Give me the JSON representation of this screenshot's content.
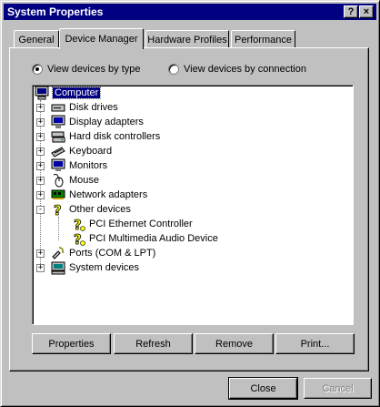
{
  "window": {
    "title": "System Properties",
    "help_glyph": "?",
    "close_glyph": "×"
  },
  "tabs": [
    {
      "label": "General"
    },
    {
      "label": "Device Manager"
    },
    {
      "label": "Hardware Profiles"
    },
    {
      "label": "Performance"
    }
  ],
  "view_options": {
    "by_type": "View devices by type",
    "by_connection": "View devices by connection",
    "selected": "by_type"
  },
  "tree": {
    "root": "Computer",
    "items": [
      {
        "label": "Disk drives",
        "icon": "disk-drive-icon",
        "expander": "+"
      },
      {
        "label": "Display adapters",
        "icon": "display-adapter-icon",
        "expander": "+"
      },
      {
        "label": "Hard disk controllers",
        "icon": "hard-disk-controller-icon",
        "expander": "+"
      },
      {
        "label": "Keyboard",
        "icon": "keyboard-icon",
        "expander": "+"
      },
      {
        "label": "Monitors",
        "icon": "monitor-icon",
        "expander": "+"
      },
      {
        "label": "Mouse",
        "icon": "mouse-icon",
        "expander": "+"
      },
      {
        "label": "Network adapters",
        "icon": "network-adapter-icon",
        "expander": "+"
      },
      {
        "label": "Other devices",
        "icon": "question-mark-icon",
        "expander": "-",
        "children": [
          {
            "label": "PCI Ethernet Controller",
            "icon": "unknown-device-icon"
          },
          {
            "label": "PCI Multimedia Audio Device",
            "icon": "unknown-device-icon"
          }
        ]
      },
      {
        "label": "Ports (COM & LPT)",
        "icon": "port-icon",
        "expander": "+"
      },
      {
        "label": "System devices",
        "icon": "system-device-icon",
        "expander": "+"
      }
    ]
  },
  "buttons": {
    "properties": "Properties",
    "refresh": "Refresh",
    "remove": "Remove",
    "print": "Print..."
  },
  "footer": {
    "close": "Close",
    "cancel": "Cancel"
  }
}
